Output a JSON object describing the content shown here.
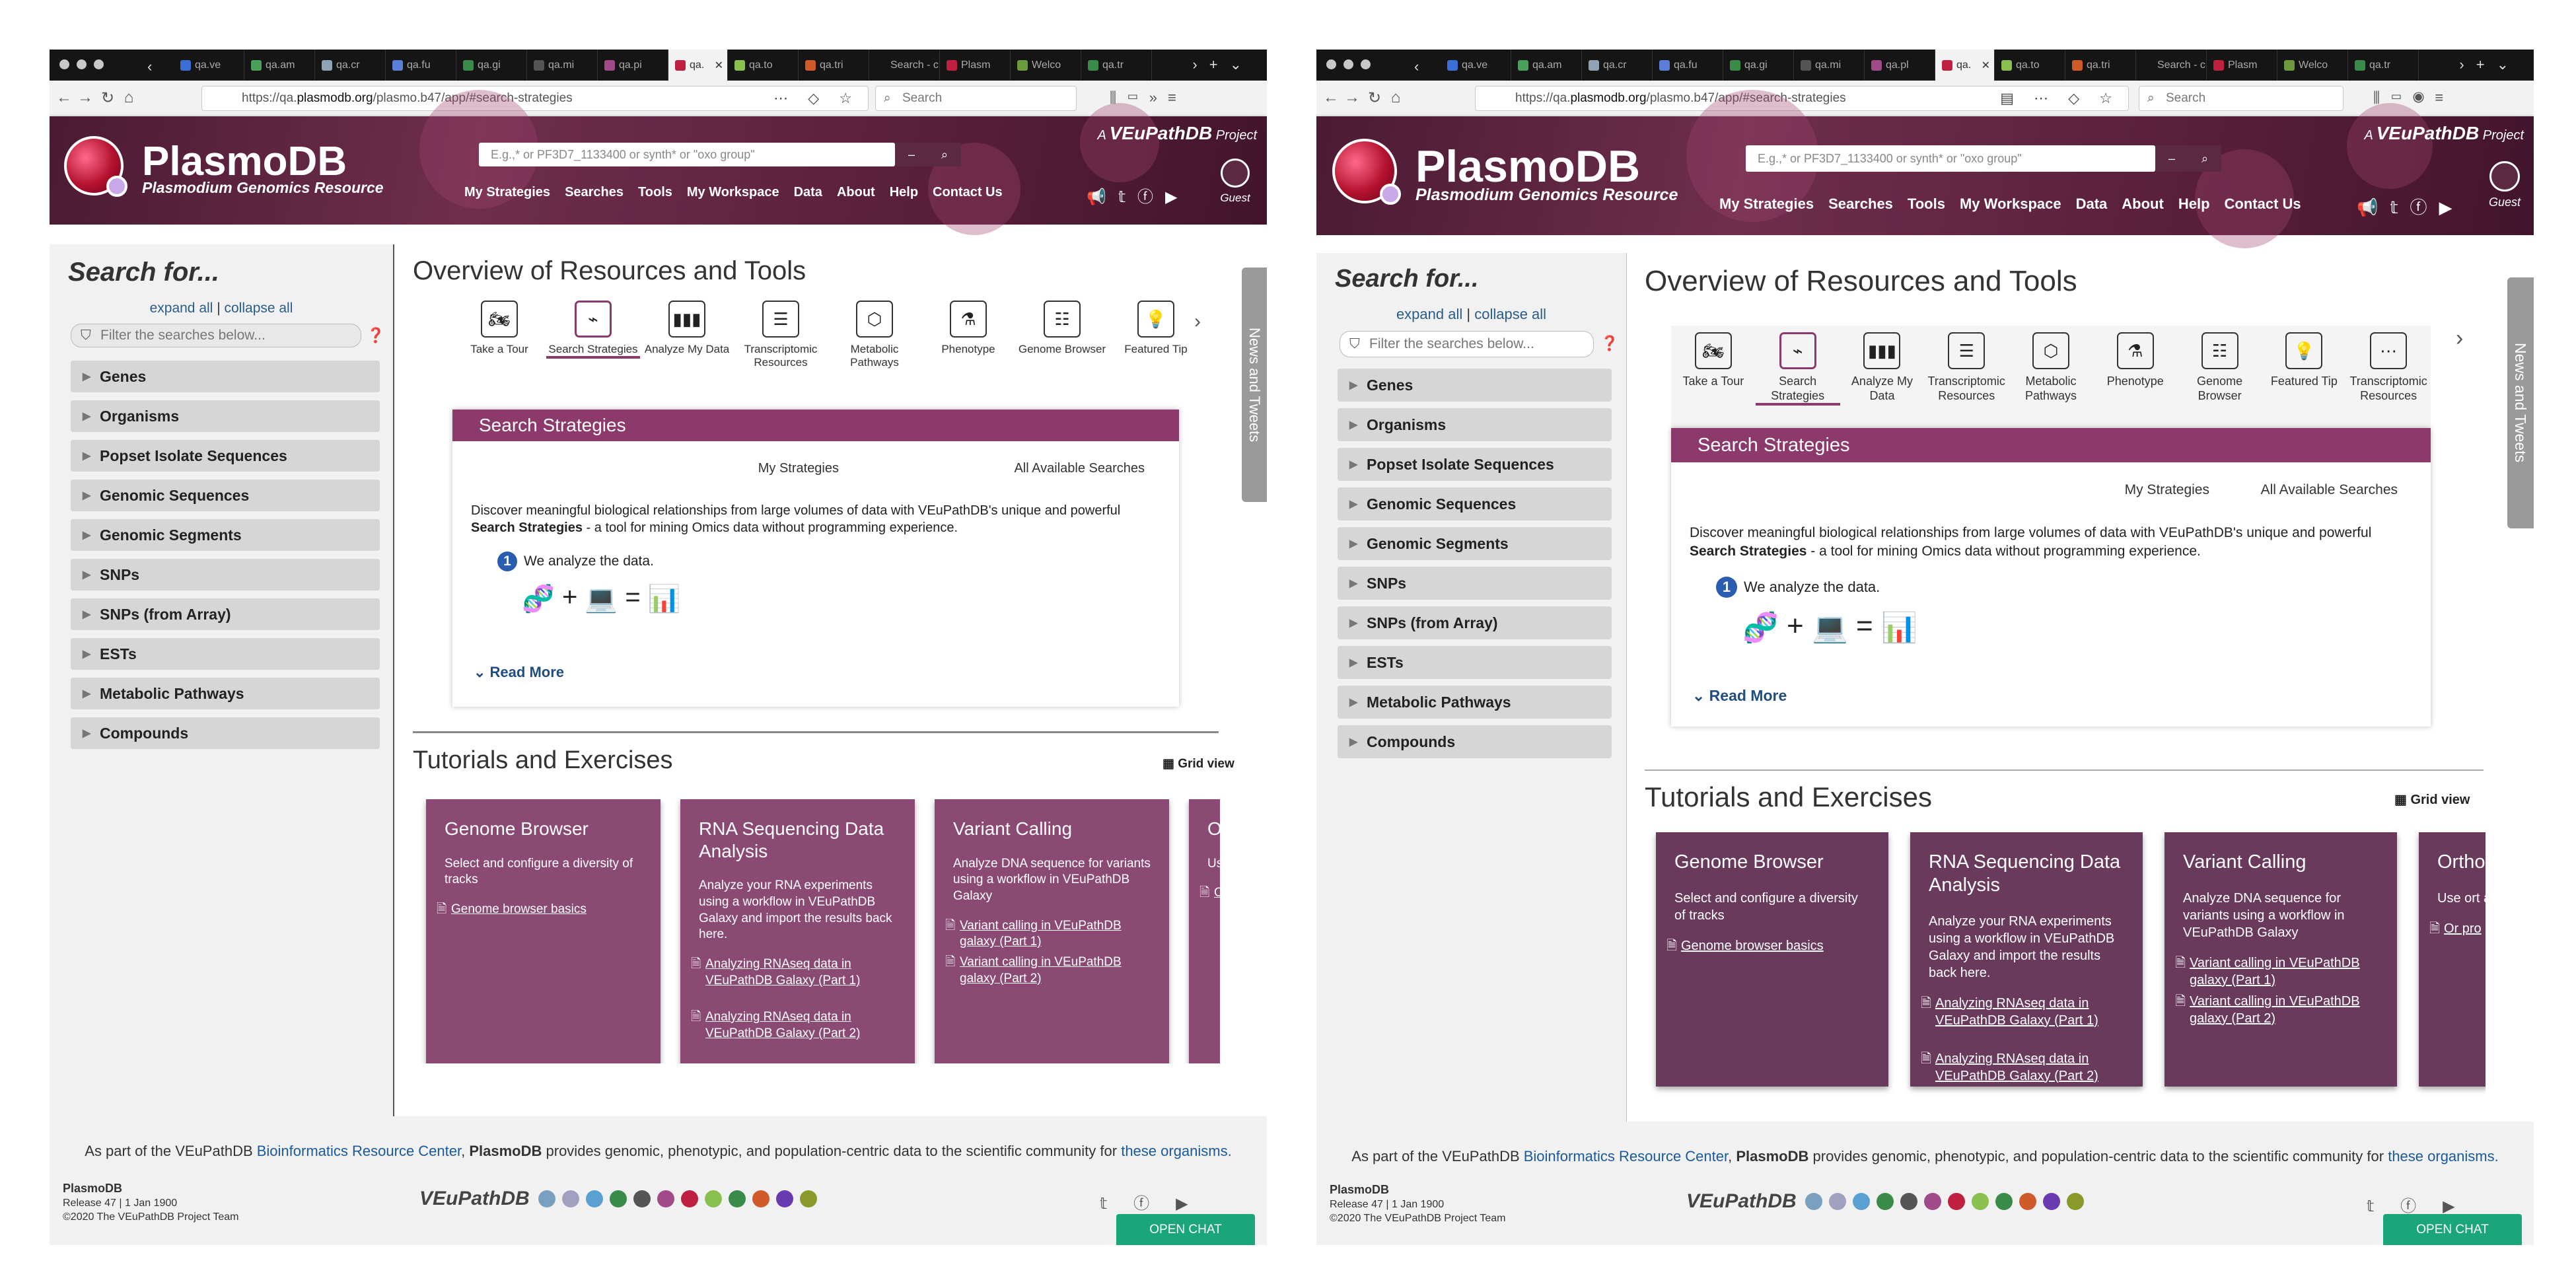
{
  "browser": {
    "tabs": [
      {
        "label": "qa.ve",
        "color": "#3b6ed6"
      },
      {
        "label": "qa.am",
        "color": "#4aa05a"
      },
      {
        "label": "qa.cr",
        "color": "#8fa3b5"
      },
      {
        "label": "qa.fu",
        "color": "#5b7fd8"
      },
      {
        "label": "qa.gi",
        "color": "#3a8a4a"
      },
      {
        "label": "qa.mi",
        "color": "#555555"
      },
      {
        "label": "qa.pi",
        "color": "#a04a8a"
      },
      {
        "label": "qa.",
        "color": "#c02040"
      },
      {
        "label": "qa.to",
        "color": "#8ac050"
      },
      {
        "label": "qa.tri",
        "color": "#d05a2a"
      },
      {
        "label": "Search - c",
        "color": "#151515"
      },
      {
        "label": "Plasm",
        "color": "#c02040"
      },
      {
        "label": "Welco",
        "color": "#6a9a3a"
      },
      {
        "label": "qa.tr",
        "color": "#3a8a4a"
      }
    ],
    "tabs_w2": [
      {
        "label": "qa.ve",
        "color": "#3b6ed6"
      },
      {
        "label": "qa.am",
        "color": "#4aa05a"
      },
      {
        "label": "qa.cr",
        "color": "#8fa3b5"
      },
      {
        "label": "qa.fu",
        "color": "#5b7fd8"
      },
      {
        "label": "qa.gi",
        "color": "#3a8a4a"
      },
      {
        "label": "qa.mi",
        "color": "#555555"
      },
      {
        "label": "qa.pl",
        "color": "#a04a8a"
      },
      {
        "label": "qa.",
        "color": "#c02040"
      },
      {
        "label": "qa.to",
        "color": "#8ac050"
      },
      {
        "label": "qa.tri",
        "color": "#d05a2a"
      },
      {
        "label": "Search - c",
        "color": "#151515"
      },
      {
        "label": "Plasm",
        "color": "#c02040"
      },
      {
        "label": "Welco",
        "color": "#6a9a3a"
      },
      {
        "label": "qa.tr",
        "color": "#3a8a4a"
      }
    ],
    "url_prefix": "https://qa.",
    "url_domain": "plasmodb.org",
    "url_path": "/plasmo.b47/app/#search-strategies",
    "search_placeholder": "Search"
  },
  "site": {
    "name": "PlasmoDB",
    "subtitle": "Plasmodium Genomics Resource",
    "project_prefix": "A",
    "project_name": "VEuPathDB",
    "project_suffix": "Project",
    "search_placeholder": "E.g.,* or PF3D7_1133400 or synth* or \"oxo group\"",
    "menu": [
      "My Strategies",
      "Searches",
      "Tools",
      "My Workspace",
      "Data",
      "About",
      "Help",
      "Contact Us"
    ],
    "guest_label": "Guest"
  },
  "sidebar": {
    "title": "Search for...",
    "expand_all": "expand all",
    "separator": "|",
    "collapse_all": "collapse all",
    "filter_placeholder": "Filter the searches below...",
    "items": [
      "Genes",
      "Organisms",
      "Popset Isolate Sequences",
      "Genomic Sequences",
      "Genomic Segments",
      "SNPs",
      "SNPs (from Array)",
      "ESTs",
      "Metabolic Pathways",
      "Compounds"
    ]
  },
  "overview": {
    "title": "Overview of Resources and Tools",
    "tools": [
      {
        "label": "Take a Tour",
        "icon": "motorcycle-icon",
        "glyph": "🏍"
      },
      {
        "label": "Search Strategies",
        "icon": "strategy-icon",
        "glyph": "⌁"
      },
      {
        "label": "Analyze My Data",
        "icon": "bar-chart-icon",
        "glyph": "▮▮▮"
      },
      {
        "label": "Transcriptomic Resources",
        "icon": "list-icon",
        "glyph": "☰"
      },
      {
        "label": "Metabolic Pathways",
        "icon": "hexagon-icon",
        "glyph": "⬡"
      },
      {
        "label": "Phenotype",
        "icon": "flask-icon",
        "glyph": "⚗"
      },
      {
        "label": "Genome Browser",
        "icon": "sliders-icon",
        "glyph": "☷"
      },
      {
        "label": "Featured Tip",
        "icon": "lightbulb-icon",
        "glyph": "💡"
      },
      {
        "label": "Transcriptomic Resources",
        "icon": "more-icon",
        "glyph": "⋯"
      }
    ],
    "panel_title": "Search Strategies",
    "my_strategies": "My Strategies",
    "all_searches": "All Available Searches",
    "description_a": "Discover meaningful biological relationships from large volumes of data with VEuPathDB's unique and powerful ",
    "description_b": "Search Strategies",
    "description_c": " - a tool for mining Omics data without programming experience.",
    "step_number": "1",
    "step_text": "We analyze the data.",
    "plus": "+",
    "equals": "=",
    "read_more": "Read More"
  },
  "tutorials": {
    "title": "Tutorials and Exercises",
    "grid_view": "Grid view",
    "cards": [
      {
        "title": "Genome Browser",
        "desc": "Select and configure a diversity of tracks",
        "links": [
          "Genome browser basics"
        ]
      },
      {
        "title": "RNA Sequencing Data Analysis",
        "desc": "Analyze your RNA experiments using a workflow in VEuPathDB Galaxy and import the results back here.",
        "links": [
          "Analyzing RNAseq data in VEuPathDB Galaxy (Part 1)",
          "Analyzing RNAseq data in VEuPathDB Galaxy (Part 2)"
        ]
      },
      {
        "title": "Variant Calling",
        "desc": "Analyze DNA sequence for variants using a workflow in VEuPathDB Galaxy",
        "links": [
          "Variant calling in VEuPathDB galaxy (Part 1)",
          "Variant calling in VEuPathDB galaxy (Part 2)"
        ]
      },
      {
        "title": "Ortho phylo",
        "desc": "Use ort and cro",
        "links": [
          "Or pro"
        ]
      }
    ]
  },
  "news_tab": "News and Tweets",
  "footer": {
    "line_a": "As part of the VEuPathDB ",
    "line_link1": "Bioinformatics Resource Center",
    "line_b": ", ",
    "line_site": "PlasmoDB",
    "line_c": " provides genomic, phenotypic, and population-centric data to the scientific community for ",
    "line_link2": "these organisms.",
    "site": "PlasmoDB",
    "release": "Release 47 | 1 Jan 1900",
    "copyright": "©2020 The VEuPathDB Project Team",
    "veupathdb": "VEuPathDB",
    "open_chat": "OPEN CHAT",
    "org_colors": [
      "#7aa0c0",
      "#a0a0c0",
      "#5aa0d0",
      "#3a8a4a",
      "#555",
      "#a04a8a",
      "#c02040",
      "#8ac050",
      "#3a8a4a",
      "#d05a2a",
      "#6a3ab0",
      "#8a9a2a"
    ]
  }
}
